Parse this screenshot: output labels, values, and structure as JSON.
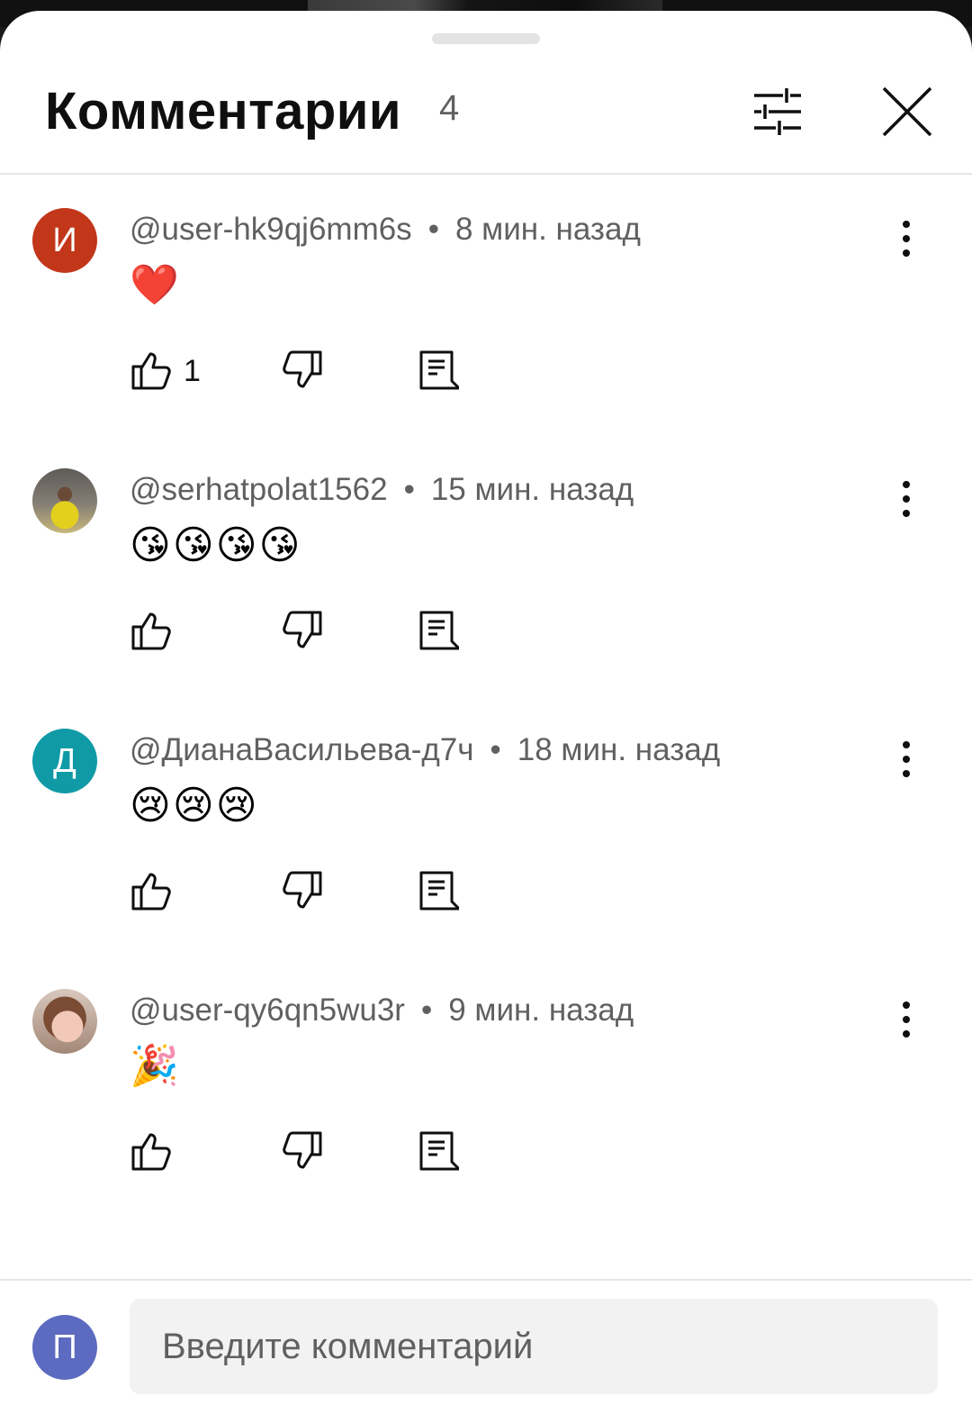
{
  "header": {
    "title": "Комментарии",
    "count": "4"
  },
  "comments": [
    {
      "author": "@user-hk9qj6mm6s",
      "time": "8 мин. назад",
      "text": "❤️",
      "likes": "1",
      "avatar_letter": "И",
      "avatar_color": "#c2361a"
    },
    {
      "author": "@serhatpolat1562",
      "time": "15 мин. назад",
      "text": "😘😘😘😘",
      "likes": "",
      "avatar_letter": "",
      "avatar_color": ""
    },
    {
      "author": "@ДианаВасильева-д7ч",
      "time": "18 мин. назад",
      "text": "😢😢😢",
      "likes": "",
      "avatar_letter": "Д",
      "avatar_color": "#0f9aa6"
    },
    {
      "author": "@user-qy6qn5wu3r",
      "time": "9 мин. назад",
      "text": "🎉",
      "likes": "",
      "avatar_letter": "",
      "avatar_color": ""
    }
  ],
  "composer": {
    "avatar_letter": "П",
    "placeholder": "Введите комментарий"
  },
  "icons": {
    "filter": "filter-sliders-icon",
    "close": "close-icon",
    "more": "more-vertical-icon",
    "like": "thumb-up-icon",
    "dislike": "thumb-down-icon",
    "reply": "reply-comment-icon"
  }
}
